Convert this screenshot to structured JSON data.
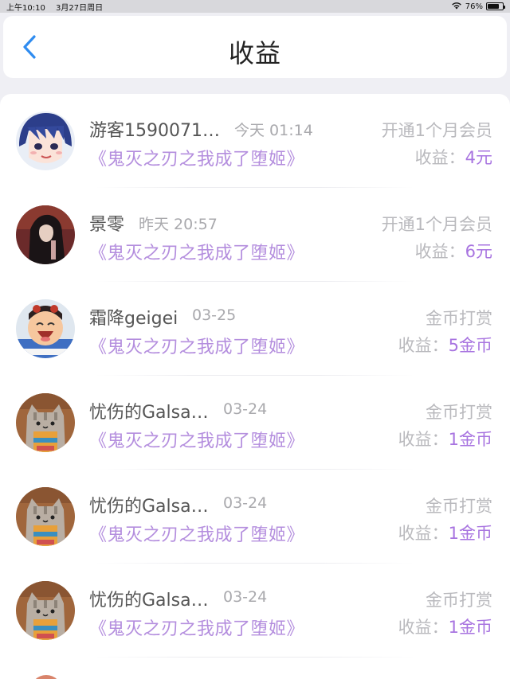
{
  "status_bar": {
    "time": "上午10:10",
    "date": "3月27日周日",
    "battery_text": "76%",
    "battery_level": 0.76
  },
  "nav": {
    "title": "收益"
  },
  "income_label": "收益：",
  "records": [
    {
      "name": "游客1590071…",
      "time": "今天 01:14",
      "book": "《鬼灭之刃之我成了堕姬》",
      "type": "开通1个月会员",
      "amount": "4元",
      "avatar": "anime-blue-hair-girl-avatar"
    },
    {
      "name": "景零",
      "time": "昨天 20:57",
      "book": "《鬼灭之刃之我成了堕姬》",
      "type": "开通1个月会员",
      "amount": "6元",
      "avatar": "dark-haired-figure-avatar"
    },
    {
      "name": "霜降geigei",
      "time": "03-25",
      "book": "《鬼灭之刃之我成了堕姬》",
      "type": "金币打赏",
      "amount": "5金币",
      "avatar": "cartoon-laughing-avatar"
    },
    {
      "name": "忧伤的Galsa…",
      "time": "03-24",
      "book": "《鬼灭之刃之我成了堕姬》",
      "type": "金币打赏",
      "amount": "1金币",
      "avatar": "pusheen-cat-avatar"
    },
    {
      "name": "忧伤的Galsa…",
      "time": "03-24",
      "book": "《鬼灭之刃之我成了堕姬》",
      "type": "金币打赏",
      "amount": "1金币",
      "avatar": "pusheen-cat-avatar"
    },
    {
      "name": "忧伤的Galsa…",
      "time": "03-24",
      "book": "《鬼灭之刃之我成了堕姬》",
      "type": "金币打赏",
      "amount": "1金币",
      "avatar": "pusheen-cat-avatar"
    }
  ],
  "colors": {
    "accent_purple": "#a874e0",
    "book_purple": "#b48ede",
    "back_blue": "#2f8cf0"
  }
}
